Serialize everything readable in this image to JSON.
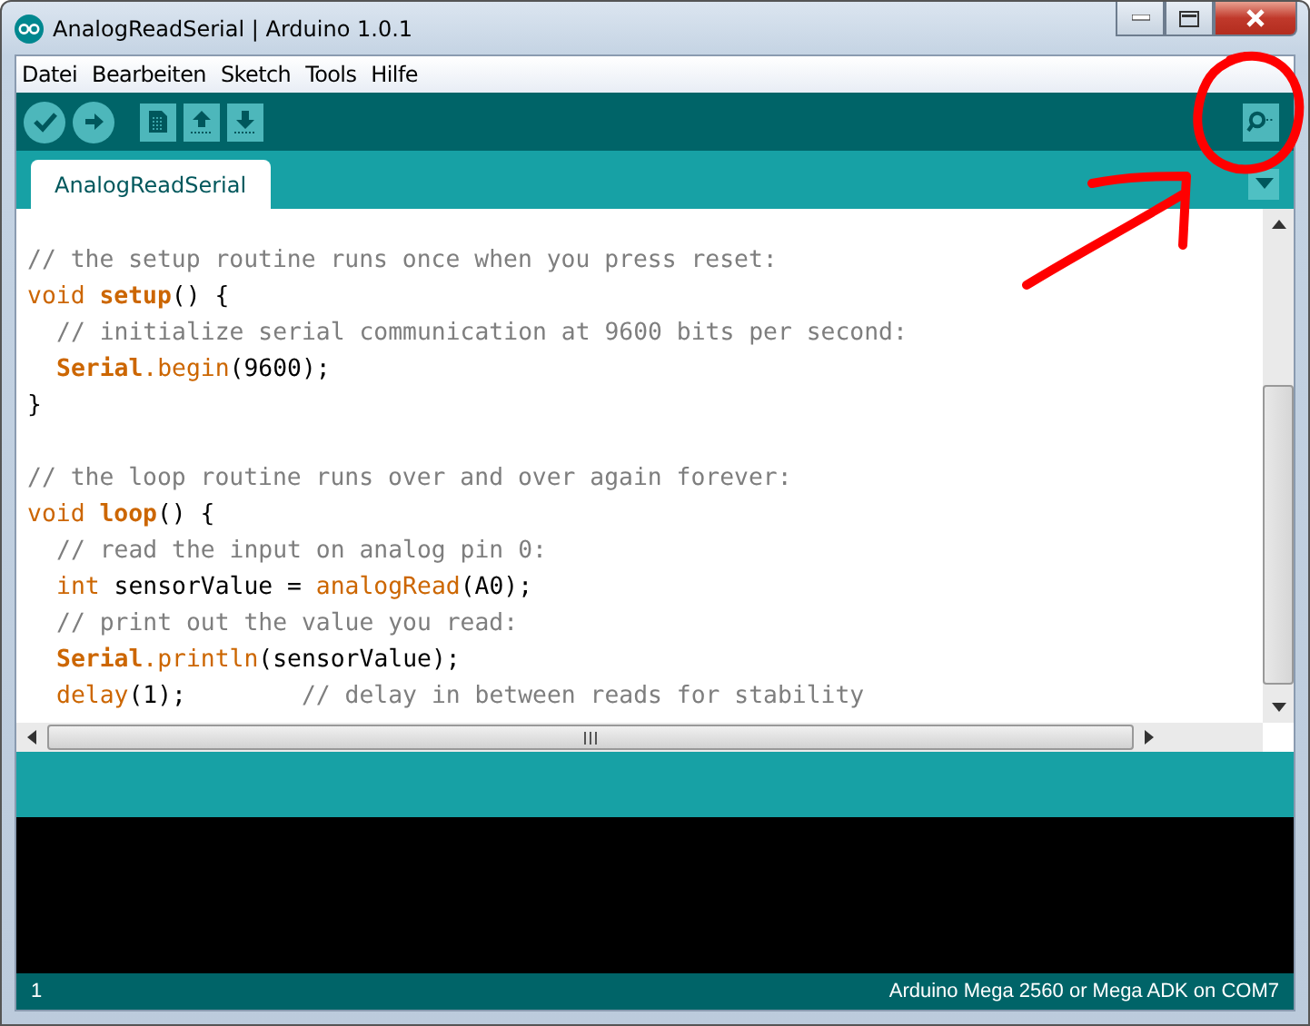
{
  "window": {
    "title": "AnalogReadSerial | Arduino 1.0.1"
  },
  "menu": [
    "Datei",
    "Bearbeiten",
    "Sketch",
    "Tools",
    "Hilfe"
  ],
  "toolbar": [
    {
      "kind": "verify"
    },
    {
      "kind": "upload"
    },
    {
      "kind": "new"
    },
    {
      "kind": "open"
    },
    {
      "kind": "save"
    }
  ],
  "tabs": [
    {
      "label": "AnalogReadSerial",
      "selected": true
    }
  ],
  "code_blocks": [
    {
      "lines": [
        {
          "indent": false,
          "tokens": [
            {
              "kind": "comment",
              "text": "// the setup routine runs once when you press reset:"
            }
          ]
        },
        {
          "indent": false,
          "tokens": [
            {
              "kind": "type",
              "text": "void "
            },
            {
              "kind": "bold",
              "text": "setup"
            },
            {
              "kind": "plain",
              "text": "() {"
            }
          ]
        },
        {
          "indent": true,
          "tokens": [
            {
              "kind": "comment",
              "text": "// initialize serial communication at 9600 bits per second:"
            }
          ]
        },
        {
          "indent": true,
          "tokens": [
            {
              "kind": "bold",
              "text": "Serial"
            },
            {
              "kind": "func",
              "text": ".begin"
            },
            {
              "kind": "plain",
              "text": "(9600);"
            }
          ]
        },
        {
          "indent": false,
          "tokens": [
            {
              "kind": "plain",
              "text": "}"
            }
          ]
        }
      ]
    },
    {
      "lines": [
        {
          "indent": false,
          "tokens": [
            {
              "kind": "comment",
              "text": "// the loop routine runs over and over again forever:"
            }
          ]
        },
        {
          "indent": false,
          "tokens": [
            {
              "kind": "type",
              "text": "void "
            },
            {
              "kind": "bold",
              "text": "loop"
            },
            {
              "kind": "plain",
              "text": "() {"
            }
          ]
        },
        {
          "indent": true,
          "tokens": [
            {
              "kind": "comment",
              "text": "// read the input on analog pin 0:"
            }
          ]
        },
        {
          "indent": true,
          "tokens": [
            {
              "kind": "type",
              "text": "int "
            },
            {
              "kind": "plain",
              "text": "sensorValue = "
            },
            {
              "kind": "func",
              "text": "analogRead"
            },
            {
              "kind": "plain",
              "text": "(A0);"
            }
          ]
        },
        {
          "indent": true,
          "tokens": [
            {
              "kind": "comment",
              "text": "// print out the value you read:"
            }
          ]
        },
        {
          "indent": true,
          "tokens": [
            {
              "kind": "bold",
              "text": "Serial"
            },
            {
              "kind": "func",
              "text": ".println"
            },
            {
              "kind": "plain",
              "text": "(sensorValue);"
            }
          ]
        },
        {
          "indent": true,
          "tokens": [
            {
              "kind": "func",
              "text": "delay"
            },
            {
              "kind": "plain",
              "text": "(1);        "
            },
            {
              "kind": "comment",
              "text": "// delay in between reads for stability"
            }
          ]
        }
      ]
    }
  ],
  "status_bar": {
    "line": "1",
    "board": "Arduino Mega 2560 or Mega ADK on COM7"
  }
}
